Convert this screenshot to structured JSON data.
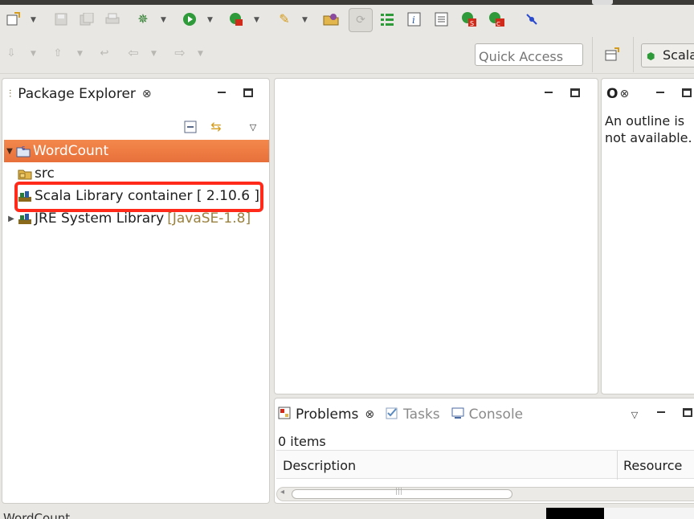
{
  "toolbar": {
    "quick_access_placeholder": "Quick Access",
    "perspective_label": "Scala"
  },
  "package_explorer": {
    "title": "Package Explorer",
    "close_glyph": "⊗",
    "tree": [
      {
        "label": "WordCount",
        "decoration": "",
        "expandable": true,
        "expanded": true,
        "selected": true,
        "icon": "scala-project-icon"
      },
      {
        "label": "src",
        "decoration": "",
        "expandable": false,
        "selected": false,
        "icon": "source-folder-icon"
      },
      {
        "label": "Scala Library container [ 2.10.6 ]",
        "decoration": "",
        "expandable": false,
        "selected": false,
        "icon": "library-icon",
        "highlighted": true
      },
      {
        "label": "JRE System Library",
        "decoration": "[JavaSE-1.8]",
        "expandable": true,
        "expanded": false,
        "selected": false,
        "icon": "library-icon"
      }
    ]
  },
  "outline": {
    "title": "O",
    "message_line1": "An outline is",
    "message_line2": "not available."
  },
  "problems": {
    "tabs": [
      {
        "label": "Problems",
        "active": true
      },
      {
        "label": "Tasks",
        "active": false
      },
      {
        "label": "Console",
        "active": false
      }
    ],
    "count_text": "0 items",
    "columns": [
      "Description",
      "Resource"
    ],
    "scroll_grip": "|||"
  },
  "status_bar": {
    "text": "WordCount"
  }
}
